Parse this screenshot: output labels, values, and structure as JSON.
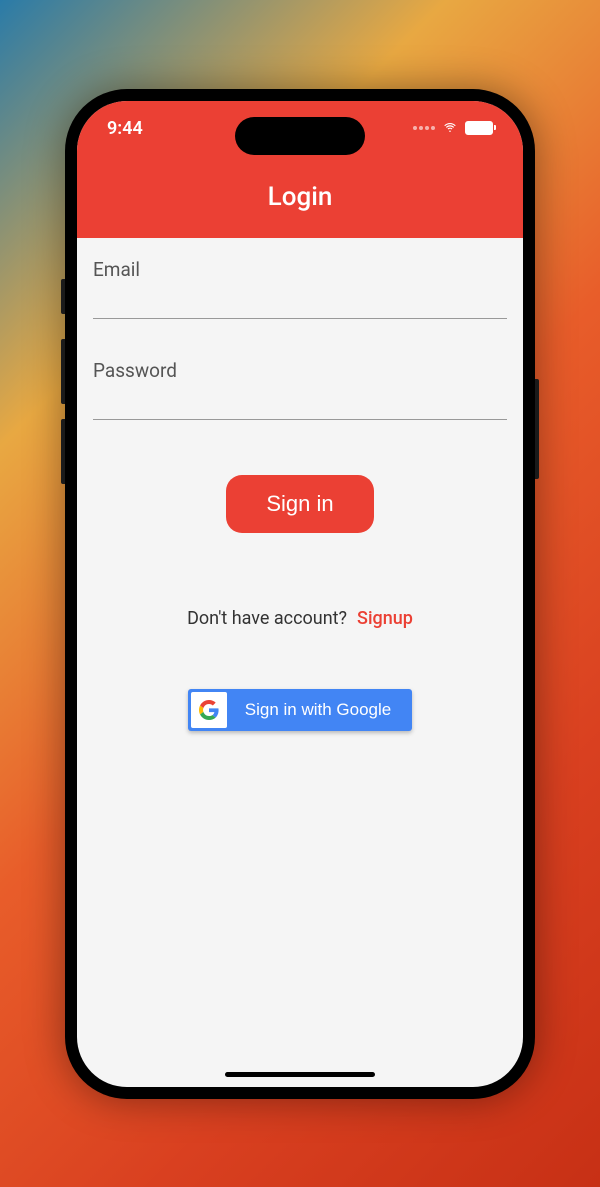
{
  "status_bar": {
    "time": "9:44"
  },
  "app_bar": {
    "title": "Login"
  },
  "form": {
    "email_label": "Email",
    "email_value": "",
    "password_label": "Password",
    "password_value": ""
  },
  "buttons": {
    "signin": "Sign in",
    "google": "Sign in with Google"
  },
  "signup": {
    "prompt": "Don't have account?",
    "link": "Signup"
  },
  "colors": {
    "primary": "#eb4034",
    "google_blue": "#4285f4"
  }
}
